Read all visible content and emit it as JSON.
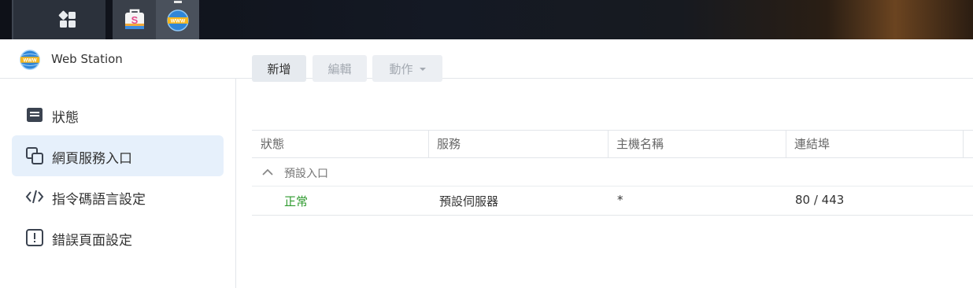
{
  "taskbar": {
    "main_menu_icon": "grid-icon",
    "apps": [
      {
        "name": "package-center-icon"
      },
      {
        "name": "web-station-icon"
      }
    ]
  },
  "window": {
    "title": "Web Station",
    "icon": "www-globe-icon"
  },
  "sidebar": {
    "items": [
      {
        "label": "狀態",
        "icon": "status-icon"
      },
      {
        "label": "網頁服務入口",
        "icon": "portal-icon",
        "active": true
      },
      {
        "label": "指令碼語言設定",
        "icon": "code-icon"
      },
      {
        "label": "錯誤頁面設定",
        "icon": "error-icon"
      }
    ]
  },
  "toolbar": {
    "new_label": "新增",
    "edit_label": "編輯",
    "action_label": "動作"
  },
  "table": {
    "columns": [
      "狀態",
      "服務",
      "主機名稱",
      "連結埠"
    ],
    "group": {
      "label": "預設入口"
    },
    "rows": [
      {
        "status": "正常",
        "service": "預設伺服器",
        "hostname": "*",
        "port": "80 / 443"
      }
    ]
  },
  "colors": {
    "accent_active_bg": "#e6f0fb",
    "status_ok": "#2e9a2e",
    "taskbar_bg": "#141924"
  }
}
